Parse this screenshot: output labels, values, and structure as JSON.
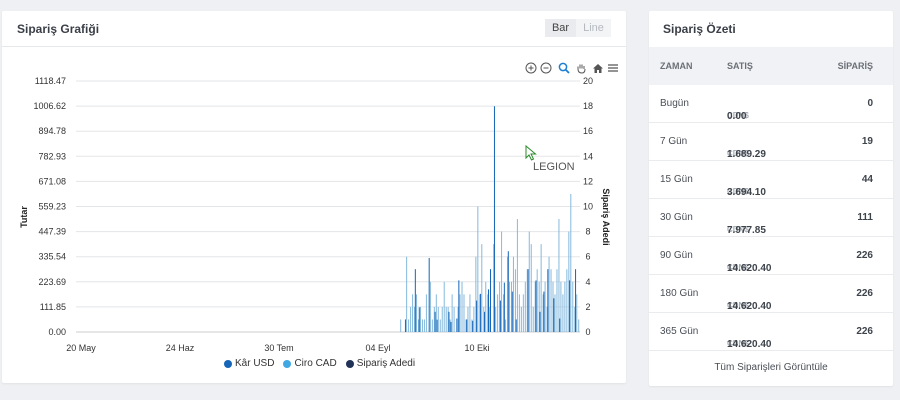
{
  "chart_panel": {
    "title": "Sipariş Grafiği",
    "toggle_bar": "Bar",
    "toggle_line": "Line",
    "tools": [
      "zoom-in-icon",
      "zoom-out-icon",
      "zoom-select-icon",
      "pan-hand-icon",
      "home-icon",
      "menu-icon"
    ],
    "annotation": "LEGION"
  },
  "chart_data": {
    "type": "bar",
    "ylabel": "Tutar",
    "y2label": "Sipariş Adedi",
    "ylim": [
      0,
      1118.47
    ],
    "y2lim": [
      0,
      20
    ],
    "y_ticks": [
      "1118.47",
      "1006.62",
      "894.78",
      "782.93",
      "671.08",
      "559.23",
      "447.39",
      "335.54",
      "223.69",
      "111.85",
      "0.00"
    ],
    "y2_ticks": [
      "20",
      "18",
      "16",
      "14",
      "12",
      "10",
      "8",
      "6",
      "4",
      "2",
      "0"
    ],
    "x_ticks": [
      "20 May",
      "24 Haz",
      "30 Tem",
      "04 Eyl",
      "10 Eki"
    ],
    "legend_position": "bottom",
    "grid": true,
    "series": [
      {
        "name": "Kâr USD",
        "color": "#1565b8",
        "values": [
          0,
          0,
          56,
          0,
          0,
          0,
          0,
          280,
          0,
          110,
          0,
          0,
          0,
          0,
          330,
          0,
          0,
          90,
          55,
          0,
          0,
          0,
          0,
          0,
          90,
          45,
          0,
          0,
          60,
          230,
          0,
          0,
          0,
          56,
          0,
          0,
          50,
          0,
          140,
          0,
          170,
          0,
          90,
          0,
          190,
          280,
          0,
          1006,
          0,
          0,
          140,
          0,
          220,
          0,
          360,
          0,
          180,
          0,
          56,
          0,
          0,
          0,
          0,
          0,
          280,
          0,
          0,
          0,
          230,
          0,
          90,
          0,
          180,
          0,
          280,
          0,
          0,
          150,
          0,
          0,
          60,
          0,
          0,
          0,
          0,
          230,
          0,
          0,
          280,
          0,
          0
        ]
      },
      {
        "name": "Ciro CAD",
        "color": "#41a8e4",
        "values": [
          0,
          0,
          0,
          0,
          0,
          0,
          0,
          0,
          0,
          0,
          0,
          0,
          0,
          0,
          0,
          0,
          0,
          0,
          0,
          0,
          0,
          0,
          0,
          0,
          0,
          0,
          0,
          0,
          0,
          0,
          0,
          0,
          0,
          0,
          0,
          0,
          0,
          0,
          0,
          0,
          0,
          0,
          0,
          0,
          0,
          0,
          0,
          0,
          0,
          0,
          0,
          0,
          0,
          0,
          0,
          0,
          0,
          0,
          0,
          0,
          0,
          0,
          0,
          0,
          0,
          0,
          0,
          0,
          0,
          0,
          0,
          0,
          0,
          0,
          0,
          0,
          0,
          0,
          0,
          0,
          0,
          0,
          0,
          0,
          0,
          0,
          0,
          0,
          0,
          0,
          0
        ]
      },
      {
        "name": "Sipariş Adedi",
        "color": "#203258",
        "values": [
          1,
          0,
          0,
          6,
          1,
          2,
          3,
          2,
          3,
          1,
          2,
          1,
          1,
          3,
          0,
          4,
          1,
          2,
          3,
          2,
          1,
          2,
          4,
          2,
          2,
          1,
          3,
          2,
          0,
          2,
          3,
          4,
          3,
          1,
          2,
          3,
          1,
          2,
          6,
          10,
          3,
          7,
          2,
          4,
          3,
          2,
          0,
          7,
          2,
          3,
          4,
          8,
          3,
          1,
          6,
          4,
          4,
          6,
          5,
          9,
          3,
          2,
          3,
          4,
          5,
          8,
          7,
          2,
          4,
          5,
          4,
          7,
          3,
          4,
          2,
          6,
          5,
          4,
          3,
          5,
          9,
          4,
          3,
          4,
          5,
          8,
          11,
          4,
          2,
          3,
          1
        ]
      }
    ]
  },
  "summary_panel": {
    "title": "Sipariş Özeti",
    "headers": {
      "zaman": "ZAMAN",
      "satis": "SATIŞ",
      "siparis": "SİPARİŞ"
    },
    "currency": "CDN$",
    "rows": [
      {
        "zaman": "Bugün",
        "satis": "0.00",
        "siparis": "0"
      },
      {
        "zaman": "7 Gün",
        "satis": "1.689.29",
        "siparis": "19"
      },
      {
        "zaman": "15 Gün",
        "satis": "3.694.10",
        "siparis": "44"
      },
      {
        "zaman": "30 Gün",
        "satis": "7.977.85",
        "siparis": "111"
      },
      {
        "zaman": "90 Gün",
        "satis": "14.620.40",
        "siparis": "226"
      },
      {
        "zaman": "180 Gün",
        "satis": "14.620.40",
        "siparis": "226"
      },
      {
        "zaman": "365 Gün",
        "satis": "14.620.40",
        "siparis": "226"
      }
    ],
    "footer_link": "Tüm Siparişleri Görüntüle"
  }
}
